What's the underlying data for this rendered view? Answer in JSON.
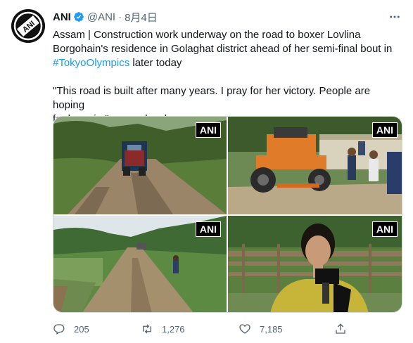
{
  "author": {
    "name": "ANI",
    "handle": "@ANI",
    "separator": "·",
    "date": "8月4日",
    "avatar_text": "ANI"
  },
  "tweet": {
    "line1": "Assam | Construction work underway on the road to boxer Lovlina",
    "line2": "Borgohain's residence in Golaghat district ahead of her semi-final bout in",
    "hashtag": "#TokyoOlympics",
    "line3_rest": " later today",
    "quote_line1": "\"This road is built after many years. I pray for her victory.  People are hoping",
    "quote_line2": "for her win,\" says a local"
  },
  "media": {
    "watermark": "ANI",
    "mic_label": "ANI"
  },
  "actions": {
    "replies": "205",
    "retweets": "1,276",
    "likes": "7,185"
  },
  "colors": {
    "accent": "#1d9bf0",
    "text": "#0f1419",
    "secondary": "#536471"
  }
}
